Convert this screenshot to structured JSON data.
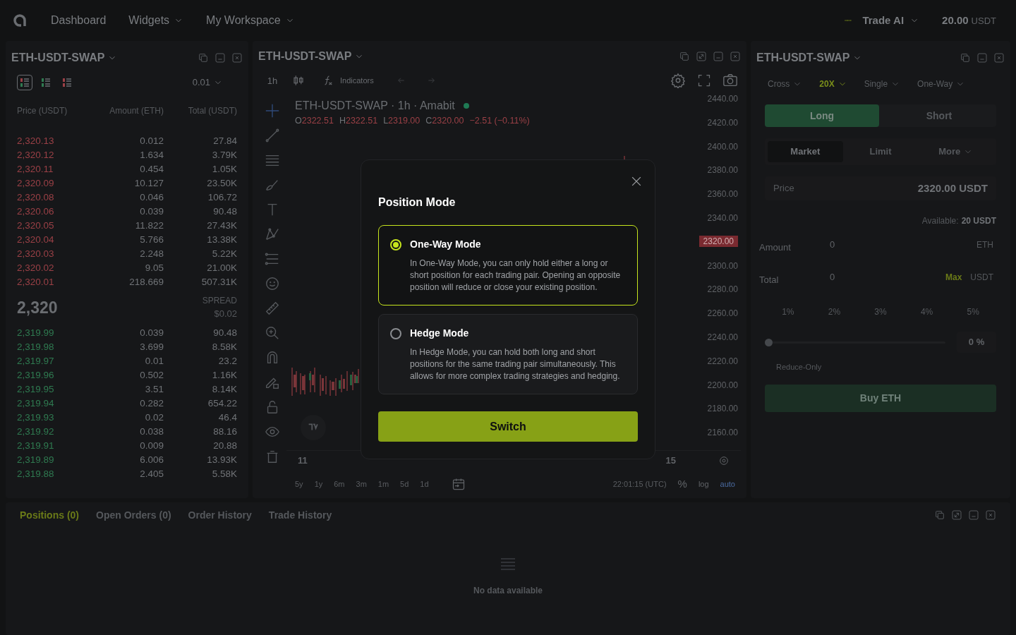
{
  "nav": {
    "items": [
      {
        "label": "Dashboard",
        "dropdown": false
      },
      {
        "label": "Widgets",
        "dropdown": true
      },
      {
        "label": "My Workspace",
        "dropdown": true
      }
    ],
    "trade_ai": {
      "label": "Trade AI"
    },
    "balance": {
      "amount": "20.00",
      "unit": "USDT"
    }
  },
  "orderbook": {
    "title": "ETH-USDT-SWAP",
    "views": [
      {
        "kind": "both",
        "selected": true
      },
      {
        "kind": "bids",
        "selected": false
      },
      {
        "kind": "asks",
        "selected": false
      }
    ],
    "depth": "0.01",
    "columns": [
      "Price (USDT)",
      "Amount (ETH)",
      "Total (USDT)"
    ],
    "asks": [
      {
        "price": "2,320.13",
        "amount": "0.012",
        "total": "27.84"
      },
      {
        "price": "2,320.12",
        "amount": "1.634",
        "total": "3.79K"
      },
      {
        "price": "2,320.11",
        "amount": "0.454",
        "total": "1.05K"
      },
      {
        "price": "2,320.09",
        "amount": "10.127",
        "total": "23.50K"
      },
      {
        "price": "2,320.08",
        "amount": "0.046",
        "total": "106.72"
      },
      {
        "price": "2,320.06",
        "amount": "0.039",
        "total": "90.48"
      },
      {
        "price": "2,320.05",
        "amount": "11.822",
        "total": "27.43K"
      },
      {
        "price": "2,320.04",
        "amount": "5.766",
        "total": "13.38K"
      },
      {
        "price": "2,320.03",
        "amount": "2.248",
        "total": "5.22K"
      },
      {
        "price": "2,320.02",
        "amount": "9.05",
        "total": "21.00K"
      },
      {
        "price": "2,320.01",
        "amount": "218.669",
        "total": "507.31K"
      }
    ],
    "last_price": "2,320",
    "spread_label": "SPREAD",
    "spread": "$0.02",
    "bids": [
      {
        "price": "2,319.99",
        "amount": "0.039",
        "total": "90.48"
      },
      {
        "price": "2,319.98",
        "amount": "3.699",
        "total": "8.58K"
      },
      {
        "price": "2,319.97",
        "amount": "0.01",
        "total": "23.2"
      },
      {
        "price": "2,319.96",
        "amount": "0.502",
        "total": "1.16K"
      },
      {
        "price": "2,319.95",
        "amount": "3.51",
        "total": "8.14K"
      },
      {
        "price": "2,319.94",
        "amount": "0.282",
        "total": "654.22"
      },
      {
        "price": "2,319.93",
        "amount": "0.02",
        "total": "46.4"
      },
      {
        "price": "2,319.92",
        "amount": "0.038",
        "total": "88.16"
      },
      {
        "price": "2,319.91",
        "amount": "0.009",
        "total": "20.88"
      },
      {
        "price": "2,319.89",
        "amount": "6.006",
        "total": "13.93K"
      },
      {
        "price": "2,319.88",
        "amount": "2.405",
        "total": "5.58K"
      }
    ]
  },
  "chart": {
    "title": "ETH-USDT-SWAP",
    "interval": "1h",
    "indicators": "Indicators",
    "legend": "ETH-USDT-SWAP · 1h · Amabit",
    "ohlc": [
      {
        "label": "O",
        "value": "2322.51"
      },
      {
        "label": "H",
        "value": "2322.51"
      },
      {
        "label": "L",
        "value": "2319.00"
      },
      {
        "label": "C",
        "value": "2320.00"
      }
    ],
    "change": "−2.51 (−0.11%)",
    "y_ticks": [
      {
        "label": "2440.00",
        "current": false
      },
      {
        "label": "2420.00",
        "current": false
      },
      {
        "label": "2400.00",
        "current": false
      },
      {
        "label": "2380.00",
        "current": false
      },
      {
        "label": "2360.00",
        "current": false
      },
      {
        "label": "2340.00",
        "current": false
      },
      {
        "label": "2320.00",
        "current": true
      },
      {
        "label": "2300.00",
        "current": false
      },
      {
        "label": "2280.00",
        "current": false
      },
      {
        "label": "2260.00",
        "current": false
      },
      {
        "label": "2240.00",
        "current": false
      },
      {
        "label": "2220.00",
        "current": false
      },
      {
        "label": "2200.00",
        "current": false
      },
      {
        "label": "2180.00",
        "current": false
      },
      {
        "label": "2160.00",
        "current": false
      }
    ],
    "x_labels": [
      "11",
      "15"
    ],
    "ranges": [
      "5y",
      "1y",
      "6m",
      "3m",
      "1m",
      "5d",
      "1d"
    ],
    "time": "22:01:15 (UTC)",
    "scales": [
      "%",
      "log",
      "auto"
    ]
  },
  "trade": {
    "title": "ETH-USDT-SWAP",
    "options": [
      {
        "label": "Cross",
        "highlighted": false
      },
      {
        "label": "20X",
        "highlighted": true
      },
      {
        "label": "Single",
        "highlighted": false
      },
      {
        "label": "One-Way",
        "highlighted": false
      }
    ],
    "sides": [
      {
        "label": "Long",
        "selected": true
      },
      {
        "label": "Short",
        "selected": false
      }
    ],
    "order_types": [
      {
        "label": "Market",
        "selected": true,
        "dropdown": false
      },
      {
        "label": "Limit",
        "selected": false,
        "dropdown": false
      },
      {
        "label": "More",
        "selected": false,
        "dropdown": true
      }
    ],
    "price": {
      "label": "Price",
      "value": "2320.00 USDT"
    },
    "available": {
      "label": "Available:",
      "value": "20 USDT"
    },
    "amount": {
      "label": "Amount",
      "value": "0",
      "unit": "ETH"
    },
    "total": {
      "label": "Total",
      "value": "0",
      "max": "Max",
      "unit": "USDT"
    },
    "percents": [
      "1%",
      "2%",
      "3%",
      "4%",
      "5%"
    ],
    "slider": {
      "level": 0,
      "reading": "0 %"
    },
    "reduce_only": "Reduce-Only",
    "submit": "Buy ETH"
  },
  "bottom": {
    "tabs": [
      {
        "label": "Positions (0)",
        "selected": true
      },
      {
        "label": "Open Orders (0)",
        "selected": false
      },
      {
        "label": "Order History",
        "selected": false
      },
      {
        "label": "Trade History",
        "selected": false
      }
    ],
    "empty": "No data available"
  },
  "modal": {
    "title": "Position Mode",
    "options": [
      {
        "title": "One-Way Mode",
        "description": "In One-Way Mode, you can only hold either a long or short position for each trading pair. Opening an opposite position will reduce or close your existing position.",
        "selected": true
      },
      {
        "title": "Hedge Mode",
        "description": "In Hedge Mode, you can hold both long and short positions for the same trading pair simultaneously. This allows for more complex trading strategies and hedging.",
        "selected": false
      }
    ],
    "button": "Switch"
  }
}
